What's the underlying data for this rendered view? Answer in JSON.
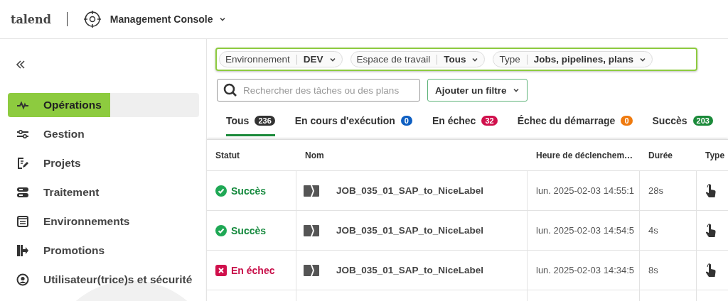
{
  "header": {
    "logo": "talend",
    "app_title": "Management Console"
  },
  "sidebar": {
    "items": [
      {
        "label": "Opérations",
        "selected": true
      },
      {
        "label": "Gestion",
        "selected": false
      },
      {
        "label": "Projets",
        "selected": false
      },
      {
        "label": "Traitement",
        "selected": false
      },
      {
        "label": "Environnements",
        "selected": false
      },
      {
        "label": "Promotions",
        "selected": false
      },
      {
        "label": "Utilisateur(trice)s et sécurité",
        "selected": false
      }
    ]
  },
  "filters": [
    {
      "label": "Environnement",
      "value": "DEV"
    },
    {
      "label": "Espace de travail",
      "value": "Tous"
    },
    {
      "label": "Type",
      "value": "Jobs, pipelines, plans"
    }
  ],
  "search": {
    "placeholder": "Rechercher des tâches ou des plans"
  },
  "add_filter": "Ajouter un filtre",
  "tabs": [
    {
      "label": "Tous",
      "count": "236",
      "color": "#333333",
      "selected": true
    },
    {
      "label": "En cours d'exécution",
      "count": "0",
      "color": "#0e5fc2",
      "selected": false
    },
    {
      "label": "En échec",
      "count": "32",
      "color": "#d0104c",
      "selected": false
    },
    {
      "label": "Échec du démarrage",
      "count": "0",
      "color": "#ef7a0e",
      "selected": false
    },
    {
      "label": "Succès",
      "count": "203",
      "color": "#1b8a3a",
      "selected": false
    }
  ],
  "table": {
    "columns": [
      "Statut",
      "Nom",
      "Heure de déclenchem…",
      "Durée",
      "Type"
    ],
    "rows": [
      {
        "status": "Succès",
        "kind": "success",
        "name": "JOB_035_01_SAP_to_NiceLabel",
        "time": "lun. 2025-02-03 14:55:1",
        "duration": "28s"
      },
      {
        "status": "Succès",
        "kind": "success",
        "name": "JOB_035_01_SAP_to_NiceLabel",
        "time": "lun. 2025-02-03 14:54:5",
        "duration": "4s"
      },
      {
        "status": "En échec",
        "kind": "failed",
        "name": "JOB_035_01_SAP_to_NiceLabel",
        "time": "lun. 2025-02-03 14:34:5",
        "duration": "8s"
      }
    ]
  }
}
